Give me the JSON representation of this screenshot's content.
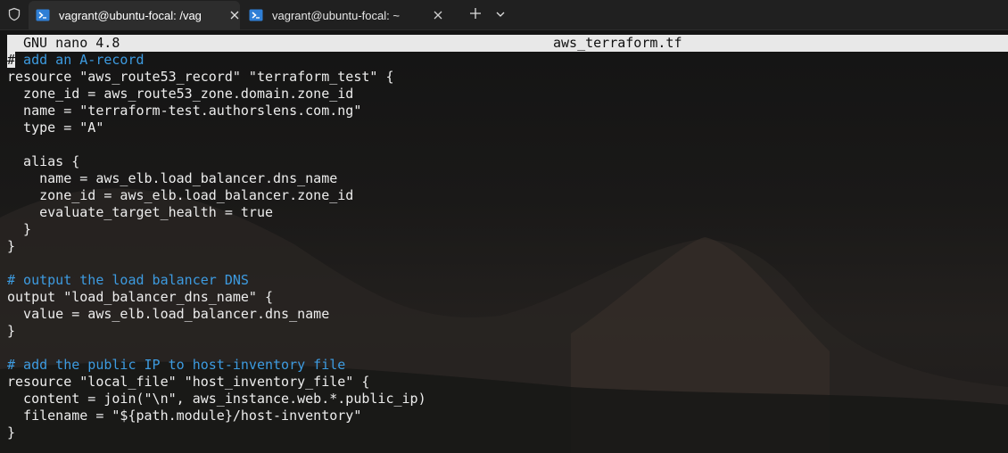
{
  "tabs": [
    {
      "title": "vagrant@ubuntu-focal: /vag",
      "active": true
    },
    {
      "title": "vagrant@ubuntu-focal: ~",
      "active": false
    }
  ],
  "editor": {
    "app_version": "GNU nano 4.8",
    "filename": "aws_terraform.tf",
    "cursor_char": "#",
    "first_line_rest": " add an A-record"
  },
  "code_lines": [
    {
      "text": "resource \"aws_route53_record\" \"terraform_test\" {",
      "kind": "code"
    },
    {
      "text": "  zone_id = aws_route53_zone.domain.zone_id",
      "kind": "code"
    },
    {
      "text": "  name = \"terraform-test.authorslens.com.ng\"",
      "kind": "code"
    },
    {
      "text": "  type = \"A\"",
      "kind": "code"
    },
    {
      "text": "",
      "kind": "code"
    },
    {
      "text": "  alias {",
      "kind": "code"
    },
    {
      "text": "    name = aws_elb.load_balancer.dns_name",
      "kind": "code"
    },
    {
      "text": "    zone_id = aws_elb.load_balancer.zone_id",
      "kind": "code"
    },
    {
      "text": "    evaluate_target_health = true",
      "kind": "code"
    },
    {
      "text": "  }",
      "kind": "code"
    },
    {
      "text": "}",
      "kind": "code"
    },
    {
      "text": "",
      "kind": "code"
    },
    {
      "text": "# output the load balancer DNS",
      "kind": "comment"
    },
    {
      "text": "output \"load_balancer_dns_name\" {",
      "kind": "code"
    },
    {
      "text": "  value = aws_elb.load_balancer.dns_name",
      "kind": "code"
    },
    {
      "text": "}",
      "kind": "code"
    },
    {
      "text": "",
      "kind": "code"
    },
    {
      "text": "# add the public IP to host-inventory file",
      "kind": "comment"
    },
    {
      "text": "resource \"local_file\" \"host_inventory_file\" {",
      "kind": "code"
    },
    {
      "text": "  content = join(\"\\n\", aws_instance.web.*.public_ip)",
      "kind": "code"
    },
    {
      "text": "  filename = \"${path.module}/host-inventory\"",
      "kind": "code"
    },
    {
      "text": "}",
      "kind": "code"
    }
  ],
  "colors": {
    "comment": "#3d9be0",
    "text": "#ededed",
    "header_bg": "#e8e8e8",
    "tab_active_bg": "#2d2d2d",
    "tabbar_bg": "#202020",
    "powershell_icon": "#2f7fd6"
  },
  "icons": {
    "shield": "shield-icon",
    "terminal": "powershell-icon",
    "close": "close-icon",
    "new_tab": "plus-icon",
    "dropdown": "chevron-down-icon"
  }
}
